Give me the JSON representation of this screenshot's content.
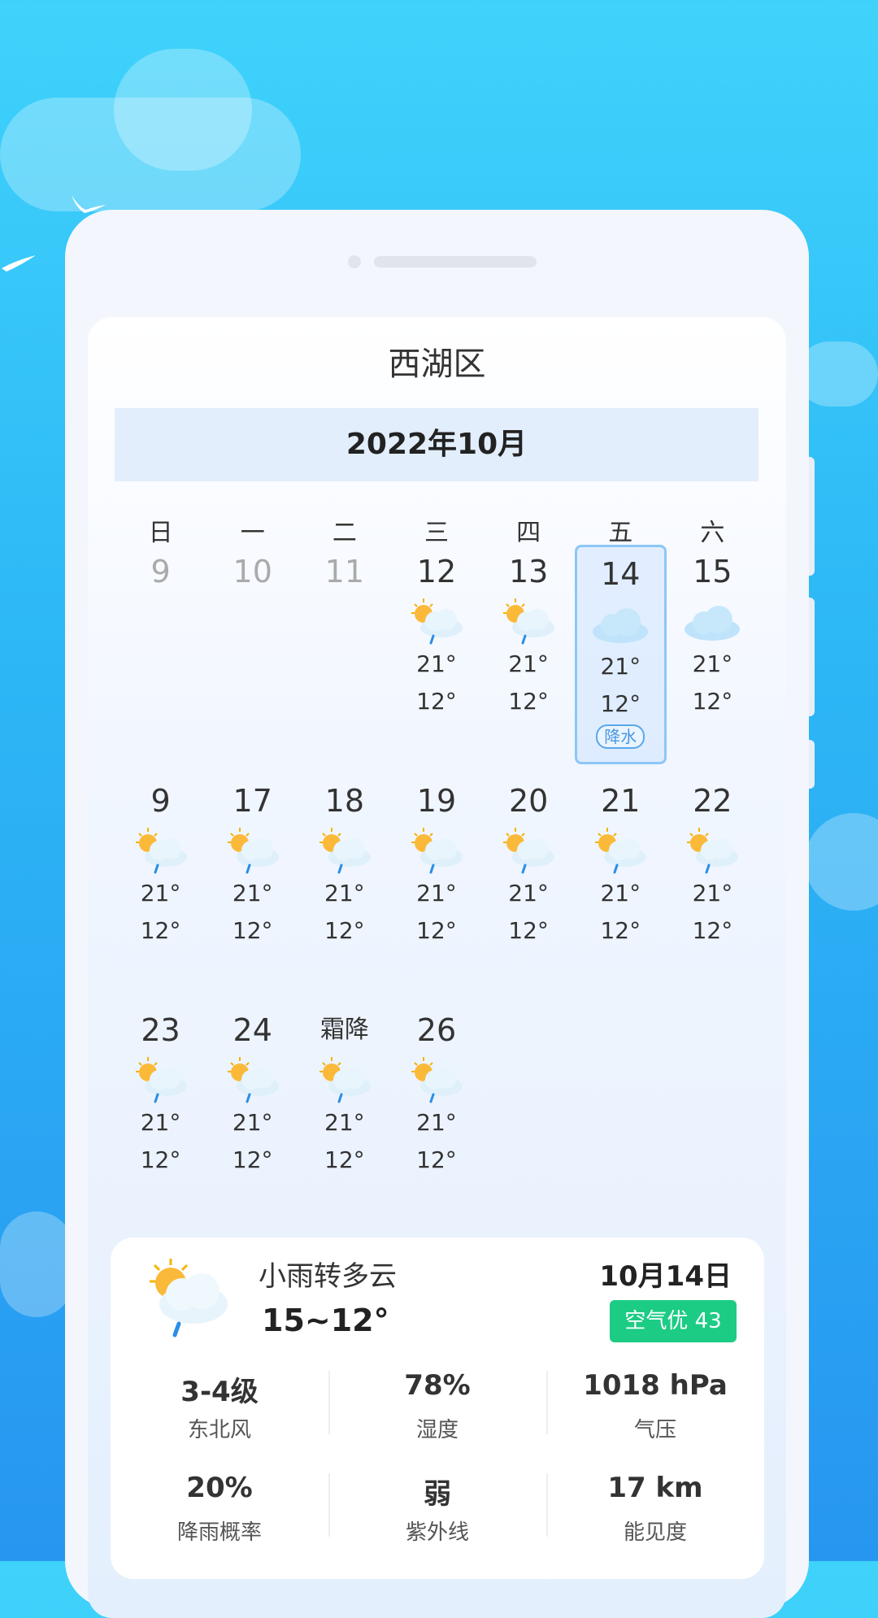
{
  "region": "西湖区",
  "month": "2022年10月",
  "weekdays": [
    "日",
    "一",
    "二",
    "三",
    "四",
    "五",
    "六"
  ],
  "rows": [
    [
      {
        "num": "9",
        "muted": true
      },
      {
        "num": "10",
        "muted": true
      },
      {
        "num": "11",
        "muted": true
      },
      {
        "num": "12",
        "icon": "sun-cloud-rain-icon",
        "high": "21°",
        "low": "12°"
      },
      {
        "num": "13",
        "icon": "sun-cloud-rain-icon",
        "high": "21°",
        "low": "12°"
      },
      {
        "num": "14",
        "icon": "cloud-icon",
        "high": "21°",
        "low": "12°",
        "selected": true,
        "tag": "降水"
      },
      {
        "num": "15",
        "icon": "cloud-icon",
        "high": "21°",
        "low": "12°"
      }
    ],
    [
      {
        "num": "9",
        "icon": "sun-cloud-rain-icon",
        "high": "21°",
        "low": "12°"
      },
      {
        "num": "17",
        "icon": "sun-cloud-rain-icon",
        "high": "21°",
        "low": "12°"
      },
      {
        "num": "18",
        "icon": "sun-cloud-rain-icon",
        "high": "21°",
        "low": "12°"
      },
      {
        "num": "19",
        "icon": "sun-cloud-rain-icon",
        "high": "21°",
        "low": "12°"
      },
      {
        "num": "20",
        "icon": "sun-cloud-rain-icon",
        "high": "21°",
        "low": "12°"
      },
      {
        "num": "21",
        "icon": "sun-cloud-rain-icon",
        "high": "21°",
        "low": "12°"
      },
      {
        "num": "22",
        "icon": "sun-cloud-rain-icon",
        "high": "21°",
        "low": "12°"
      }
    ],
    [
      {
        "num": "23",
        "icon": "sun-cloud-rain-icon",
        "high": "21°",
        "low": "12°"
      },
      {
        "num": "24",
        "icon": "sun-cloud-rain-icon",
        "high": "21°",
        "low": "12°"
      },
      {
        "num": "霜降",
        "icon": "sun-cloud-rain-icon",
        "high": "21°",
        "low": "12°",
        "term": true
      },
      {
        "num": "26",
        "icon": "sun-cloud-rain-icon",
        "high": "21°",
        "low": "12°"
      }
    ]
  ],
  "detail": {
    "condition": "小雨转多云",
    "range": "15~12°",
    "date": "10月14日",
    "aqi": "空气优 43",
    "icon": "sun-cloud-rain-icon",
    "stats": [
      {
        "value": "3-4级",
        "label": "东北风"
      },
      {
        "value": "78%",
        "label": "湿度"
      },
      {
        "value": "1018 hPa",
        "label": "气压"
      },
      {
        "value": "20%",
        "label": "降雨概率"
      },
      {
        "value": "弱",
        "label": "紫外线"
      },
      {
        "value": "17 km",
        "label": "能见度"
      }
    ]
  },
  "colors": {
    "accent": "#2db8f6",
    "aqi_good": "#1ccc84",
    "tag": "#4a97e0"
  }
}
